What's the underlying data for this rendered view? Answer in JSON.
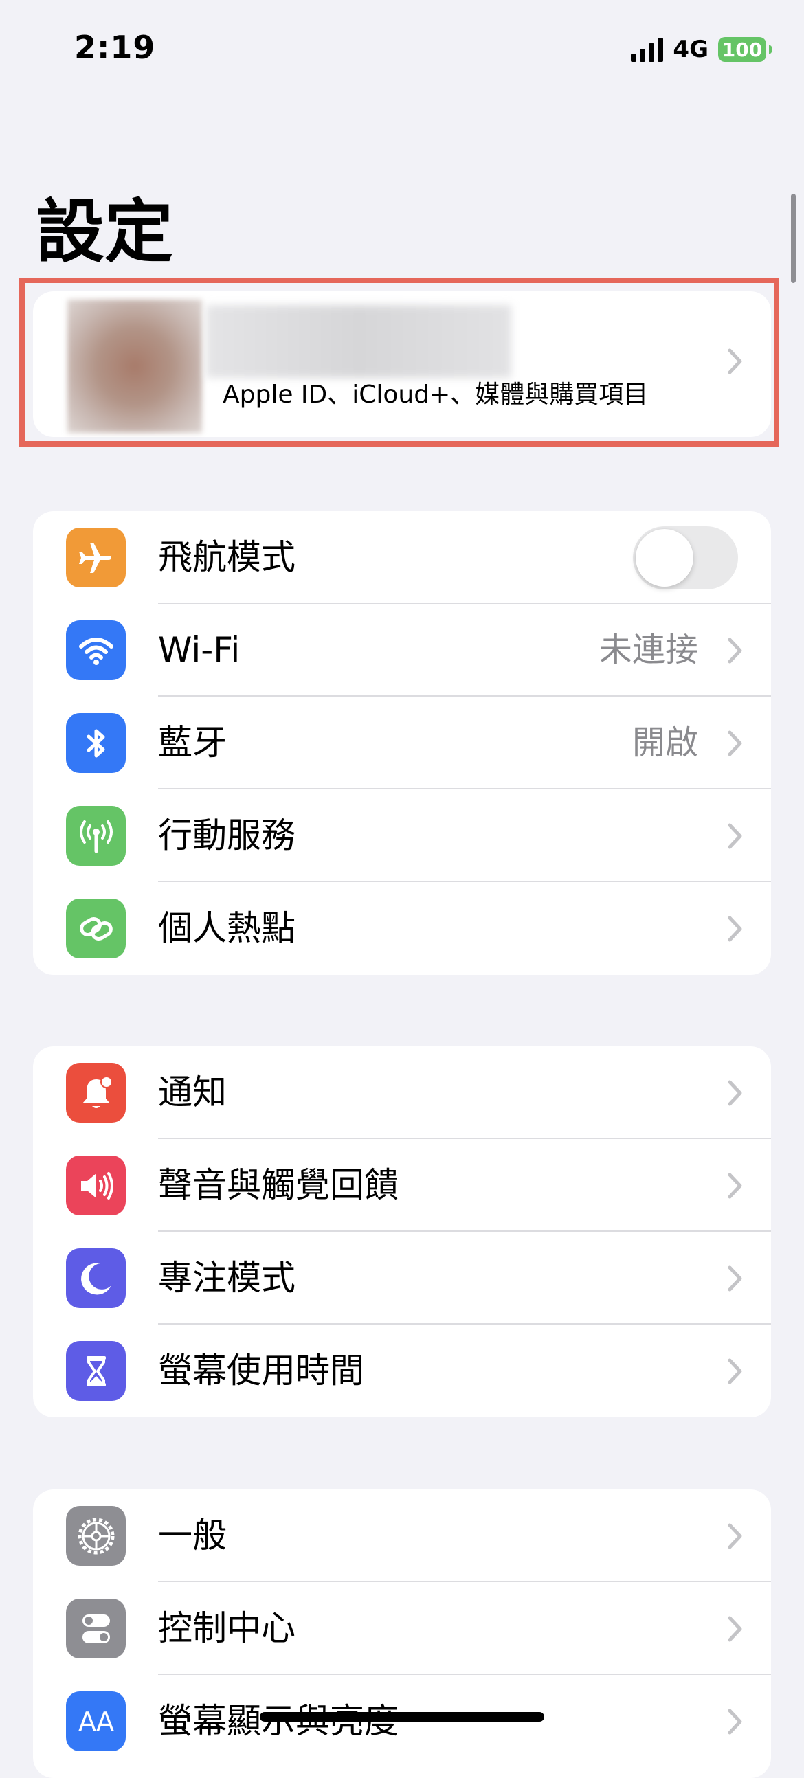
{
  "status_bar": {
    "time": "2:19",
    "network": "4G",
    "battery": "100"
  },
  "title": "設定",
  "profile": {
    "subtitle": "Apple ID、iCloud+、媒體與購買項目"
  },
  "groups": [
    {
      "items": [
        {
          "label": "飛航模式",
          "icon": "airplane-icon",
          "color": "#f19a37",
          "toggle": false
        },
        {
          "label": "Wi-Fi",
          "value": "未連接",
          "icon": "wifi-icon",
          "color": "#3478f6"
        },
        {
          "label": "藍牙",
          "value": "開啟",
          "icon": "bluetooth-icon",
          "color": "#3478f6"
        },
        {
          "label": "行動服務",
          "icon": "cellular-icon",
          "color": "#65c466"
        },
        {
          "label": "個人熱點",
          "icon": "hotspot-icon",
          "color": "#65c466"
        }
      ]
    },
    {
      "items": [
        {
          "label": "通知",
          "icon": "notifications-icon",
          "color": "#eb4e3d"
        },
        {
          "label": "聲音與觸覺回饋",
          "icon": "sound-icon",
          "color": "#eb445a"
        },
        {
          "label": "專注模式",
          "icon": "focus-moon-icon",
          "color": "#5e5ce6"
        },
        {
          "label": "螢幕使用時間",
          "icon": "hourglass-icon",
          "color": "#5e5ce6"
        }
      ]
    },
    {
      "items": [
        {
          "label": "一般",
          "icon": "gear-icon",
          "color": "#8e8e93"
        },
        {
          "label": "控制中心",
          "icon": "control-center-icon",
          "color": "#8e8e93"
        },
        {
          "label": "螢幕顯示與亮度",
          "icon": "display-brightness-icon",
          "color": "#3478f6",
          "icon_text": "AA"
        }
      ]
    }
  ]
}
